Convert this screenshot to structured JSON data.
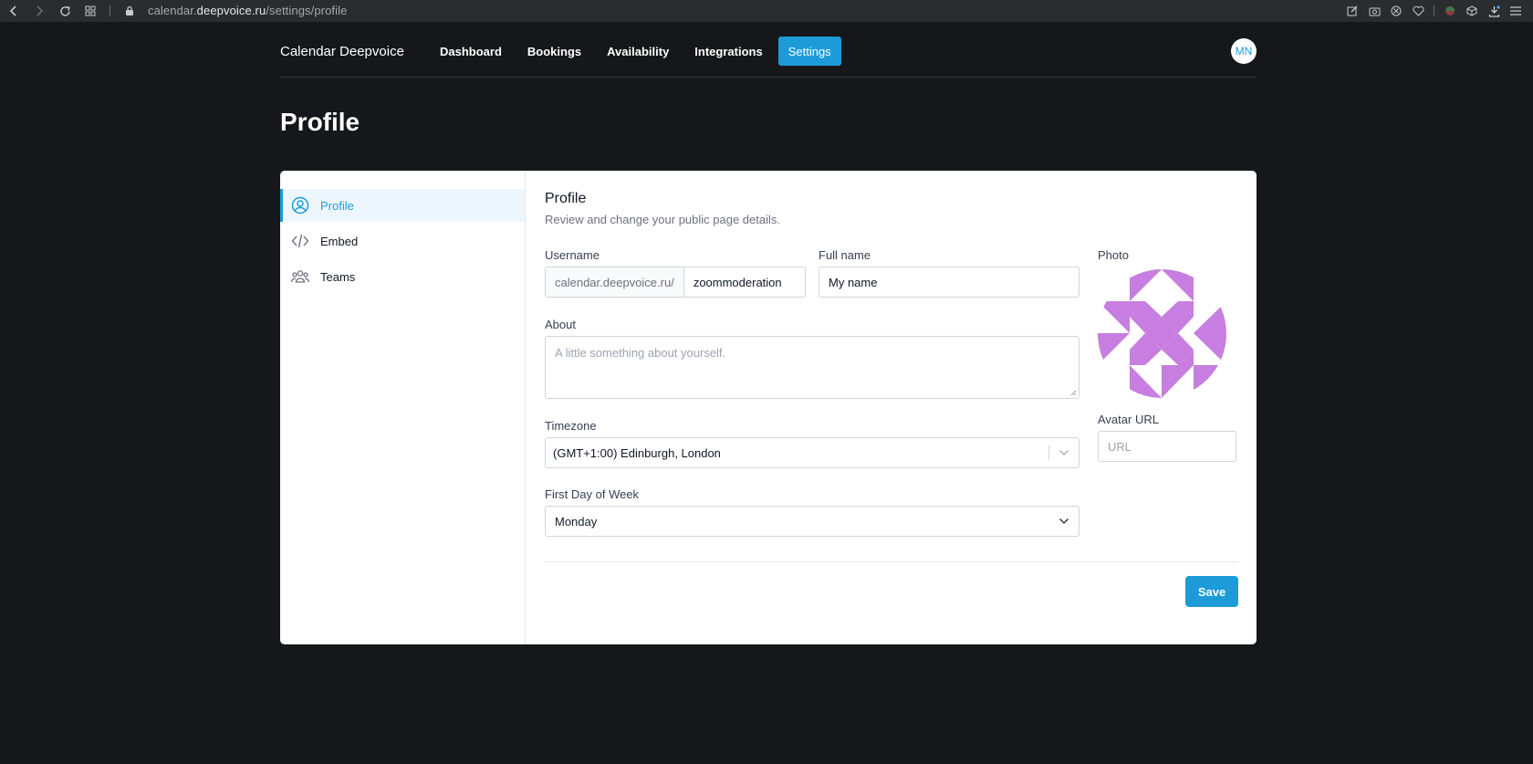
{
  "browser": {
    "url_prefix": "calendar.",
    "url_domain": "deepvoice.ru",
    "url_path": "/settings/profile"
  },
  "nav": {
    "brand": "Calendar Deepvoice",
    "links": [
      "Dashboard",
      "Bookings",
      "Availability",
      "Integrations",
      "Settings"
    ],
    "active": "Settings",
    "user_initials": "MN"
  },
  "page": {
    "title": "Profile"
  },
  "sidebar": {
    "items": [
      {
        "label": "Profile",
        "icon": "user-circle-icon",
        "active": true
      },
      {
        "label": "Embed",
        "icon": "code-icon",
        "active": false
      },
      {
        "label": "Teams",
        "icon": "users-icon",
        "active": false
      }
    ]
  },
  "profile": {
    "title": "Profile",
    "subtitle": "Review and change your public page details.",
    "username_label": "Username",
    "username_prefix": "calendar.deepvoice.ru/",
    "username_value": "zoommoderation",
    "fullname_label": "Full name",
    "fullname_value": "My name",
    "about_label": "About",
    "about_placeholder": "A little something about yourself.",
    "timezone_label": "Timezone",
    "timezone_value": "(GMT+1:00) Edinburgh, London",
    "firstday_label": "First Day of Week",
    "firstday_value": "Monday",
    "photo_label": "Photo",
    "avatar_url_label": "Avatar URL",
    "avatar_url_placeholder": "URL",
    "save_label": "Save"
  },
  "colors": {
    "accent": "#1d9bd8",
    "avatar_pattern": "#c77ee0",
    "background": "#16171a"
  }
}
